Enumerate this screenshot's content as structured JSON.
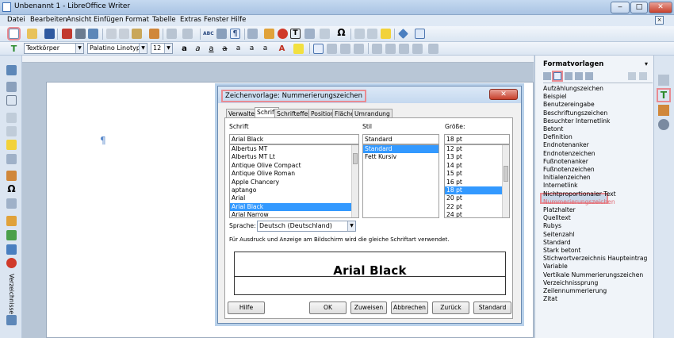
{
  "window": {
    "title": "Unbenannt 1 - LibreOffice Writer",
    "minimize": "‒",
    "maximize": "□",
    "close": "✕"
  },
  "menu": [
    "Datei",
    "Bearbeiten",
    "Ansicht",
    "Einfügen",
    "Format",
    "Tabelle",
    "Extras",
    "Fenster",
    "Hilfe"
  ],
  "formatting": {
    "paragraph_style": "Textkörper",
    "font_name": "Palatino Linotype",
    "font_size": "12"
  },
  "document": {
    "pilcrow": "¶"
  },
  "navigator_label": "Verzeichnisse",
  "sidebar": {
    "title": "Formatvorlagen",
    "styles": [
      "Aufzählungszeichen",
      "Beispiel",
      "Benutzereingabe",
      "Beschriftungszeichen",
      "Besuchter Internetlink",
      "Betont",
      "Definition",
      "Endnotenanker",
      "Endnotenzeichen",
      "Fußnotenanker",
      "Fußnotenzeichen",
      "Initialenzeichen",
      "Internetlink",
      "Nichtproportionaler Text",
      "Nummerierungszeichen",
      "Platzhalter",
      "Quelltext",
      "Rubys",
      "Seitenzahl",
      "Standard",
      "Stark betont",
      "Stichwortverzeichnis Haupteintrag",
      "Variable",
      "Vertikale Nummerierungszeichen",
      "Verzeichnissprung",
      "Zeilennummerierung",
      "Zitat"
    ],
    "selected_style": "Nummerierungszeichen"
  },
  "dialog": {
    "title": "Zeichenvorlage: Nummerierungszeichen",
    "close": "✕",
    "tabs": [
      "Verwalten",
      "Schrift",
      "Schrifteffekt",
      "Position",
      "Fläche",
      "Umrandung"
    ],
    "active_tab": "Schrift",
    "font_label": "Schrift",
    "font_value": "Arial Black",
    "fonts": [
      "Albertus MT",
      "Albertus MT Lt",
      "Antique Olive Compact",
      "Antique Olive Roman",
      "Apple Chancery",
      "aptango",
      "Arial",
      "Arial Black",
      "Arial Narrow"
    ],
    "style_label": "Stil",
    "style_value": "Standard",
    "styles": [
      "Standard",
      "Fett Kursiv"
    ],
    "size_label": "Größe:",
    "size_value": "18 pt",
    "sizes": [
      "12 pt",
      "13 pt",
      "14 pt",
      "15 pt",
      "16 pt",
      "18 pt",
      "20 pt",
      "22 pt",
      "24 pt"
    ],
    "language_label": "Sprache:",
    "language_value": "Deutsch (Deutschland)",
    "info_text": "Für Ausdruck und Anzeige am Bildschirm wird die gleiche Schriftart verwendet.",
    "preview_text": "Arial Black",
    "buttons": {
      "help": "Hilfe",
      "ok": "OK",
      "cancel": "Abbrechen",
      "reset": "Zurück",
      "standard": "Standard"
    },
    "apply_label": "Zuweisen"
  }
}
